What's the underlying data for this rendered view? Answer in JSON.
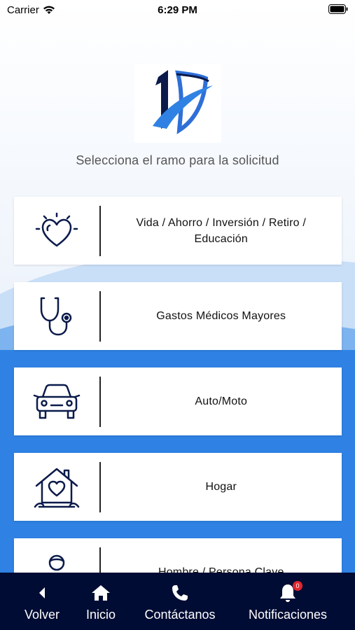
{
  "status_bar": {
    "carrier": "Carrier",
    "time": "6:29 PM"
  },
  "header": {
    "subtitle": "Selecciona el ramo para la solicitud"
  },
  "options": [
    {
      "label": "Vida / Ahorro / Inversión / Retiro / Educación",
      "icon": "heart-glow-icon"
    },
    {
      "label": "Gastos Médicos Mayores",
      "icon": "stethoscope-icon"
    },
    {
      "label": "Auto/Moto",
      "icon": "car-icon"
    },
    {
      "label": "Hogar",
      "icon": "house-heart-icon"
    },
    {
      "label": "Hombre / Persona Clave",
      "icon": "person-icon"
    }
  ],
  "tabbar": {
    "back": "Volver",
    "home": "Inicio",
    "contact": "Contáctanos",
    "notifications": "Notificaciones",
    "notifications_badge": "0"
  },
  "colors": {
    "tabbar_bg": "#000c33",
    "wave_blue": "#2f82e3",
    "badge_red": "#e0262e"
  }
}
